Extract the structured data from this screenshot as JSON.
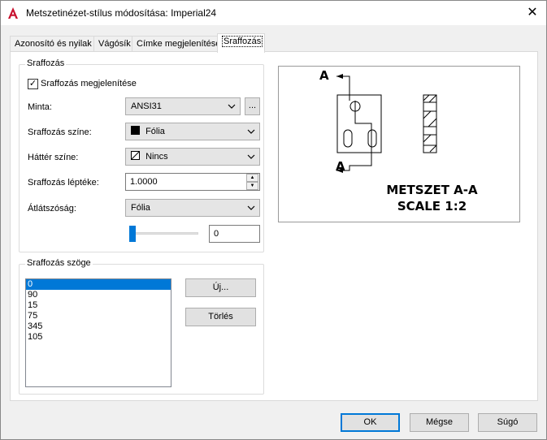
{
  "window": {
    "title": "Metszetinézet-stílus módosítása: Imperial24",
    "close_glyph": "✕",
    "accent_color": "#0078d7",
    "app_icon_color": "#c8102e"
  },
  "tabs": [
    {
      "label": "Azonosító és nyilak",
      "active": false
    },
    {
      "label": "Vágósík",
      "active": false
    },
    {
      "label": "Címke megjelenítése",
      "active": false
    },
    {
      "label": "Sraffozás",
      "active": true
    }
  ],
  "hatch_group": {
    "title": "Sraffozás",
    "show_hatch": {
      "label": "Sraffozás megjelenítése",
      "checked": true,
      "check_glyph": "✓"
    },
    "pattern": {
      "label": "Minta:",
      "value": "ANSI31",
      "browse_label": "..."
    },
    "hatch_color": {
      "label": "Sraffozás színe:",
      "value": "Fólia"
    },
    "background_color": {
      "label": "Háttér színe:",
      "value": "Nincs"
    },
    "hatch_scale": {
      "label": "Sraffozás léptéke:",
      "value": "1.0000"
    },
    "transparency": {
      "label": "Átlátszóság:",
      "value": "Fólia",
      "slider_level": 0,
      "numeric_value": "0"
    }
  },
  "angle_group": {
    "title": "Sraffozás szöge",
    "angles": [
      "0",
      "90",
      "15",
      "75",
      "345",
      "105"
    ],
    "selected_index": 0,
    "new_button": "Új...",
    "delete_button": "Törlés"
  },
  "preview": {
    "label_top": "A",
    "label_bottom": "A",
    "caption_line1": "METSZET A-A",
    "caption_line2": "SCALE 1:2"
  },
  "footer": {
    "ok": "OK",
    "cancel": "Mégse",
    "help": "Súgó"
  }
}
